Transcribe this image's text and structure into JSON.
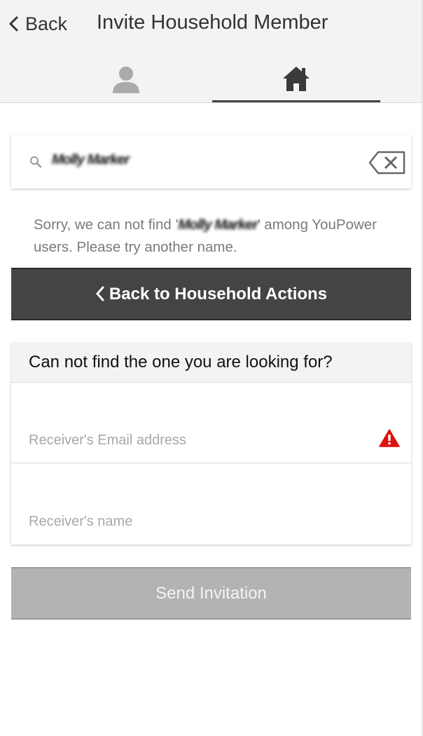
{
  "header": {
    "back_label": "Back",
    "title": "Invite Household Member",
    "tabs": [
      {
        "icon": "person-icon",
        "active": false
      },
      {
        "icon": "home-icon",
        "active": true
      }
    ]
  },
  "search": {
    "value": "Molly Marker"
  },
  "message": {
    "prefix": "Sorry, we can not find '",
    "query": "Molly Marker",
    "suffix": "' among YouPower users. Please try another name."
  },
  "back_action": {
    "label": "Back to Household Actions"
  },
  "invite_card": {
    "heading": "Can not find the one you are looking for?",
    "email_placeholder": "Receiver's Email address",
    "email_value": "",
    "name_placeholder": "Receiver's name",
    "name_value": ""
  },
  "send_button": {
    "label": "Send Invitation"
  },
  "colors": {
    "header_bg": "#f3f3f3",
    "dark_button": "#444444",
    "disabled_button": "#b3b3b3",
    "warning": "#e01010"
  }
}
